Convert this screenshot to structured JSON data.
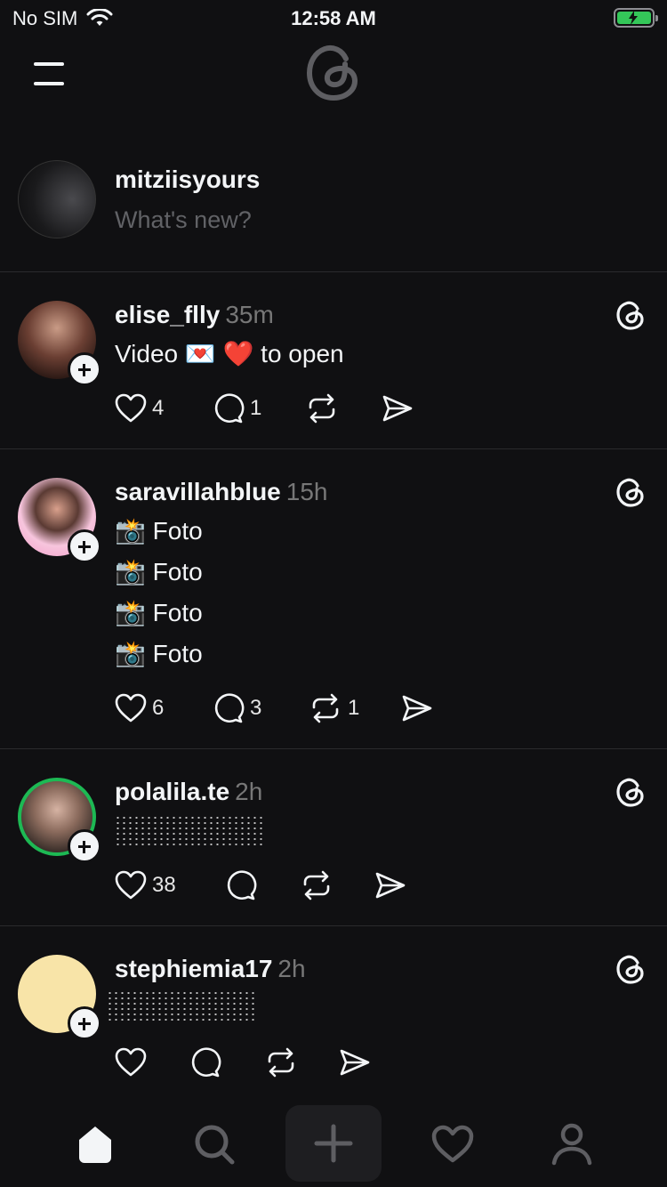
{
  "status_bar": {
    "carrier": "No SIM",
    "time": "12:58 AM"
  },
  "composer": {
    "username": "mitziisyours",
    "placeholder": "What's new?"
  },
  "posts": [
    {
      "username": "elise_flly",
      "time": "35m",
      "text": "Video 💌 ❤️ to open",
      "likes": "4",
      "replies": "1",
      "reposts": ""
    },
    {
      "username": "saravillahblue",
      "time": "15h",
      "lines": [
        "📸 Foto",
        "📸 Foto",
        "📸 Foto",
        "📸 Foto"
      ],
      "likes": "6",
      "replies": "3",
      "reposts": "1"
    },
    {
      "username": "polalila.te",
      "time": "2h",
      "likes": "38",
      "replies": "",
      "reposts": ""
    },
    {
      "username": "stephiemia17",
      "time": "2h",
      "likes": "",
      "replies": "",
      "reposts": ""
    }
  ],
  "colors": {
    "background": "#101012",
    "text": "#f3f5f7",
    "muted": "#777777",
    "divider": "#2a2a2d",
    "battery": "#34c759"
  },
  "icons": [
    "wifi-icon",
    "battery-icon",
    "menu-icon",
    "threads-logo-icon",
    "heart-icon",
    "comment-icon",
    "repost-icon",
    "share-icon",
    "home-icon",
    "search-icon",
    "compose-icon",
    "activity-icon",
    "profile-icon"
  ]
}
